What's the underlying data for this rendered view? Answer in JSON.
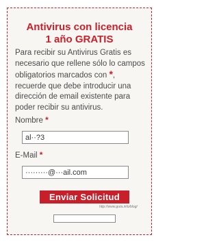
{
  "form": {
    "title_line1": "Antivirus con licencia",
    "title_line2": "1 año GRATIS",
    "intro_part1": "Para recibir su Antivirus Gratis es necesario que rellene sólo lo campos obligatorios marcados con",
    "required_mark": "*",
    "intro_part2": ", recuerde que debe introducir una dirección de email existente para poder recibir su antivirus.",
    "name_label": "Nombre",
    "name_value": "al··?3",
    "email_label": "E-Mail",
    "email_value": "·········@···ail.com",
    "submit_label": "Enviar Solicitud",
    "credit_text": "http://www.guía.info/blog/",
    "bottom_field_value": ""
  },
  "colors": {
    "accent": "#c8202a",
    "panel_bg": "#f7f6f3",
    "text": "#4a4a4a"
  }
}
